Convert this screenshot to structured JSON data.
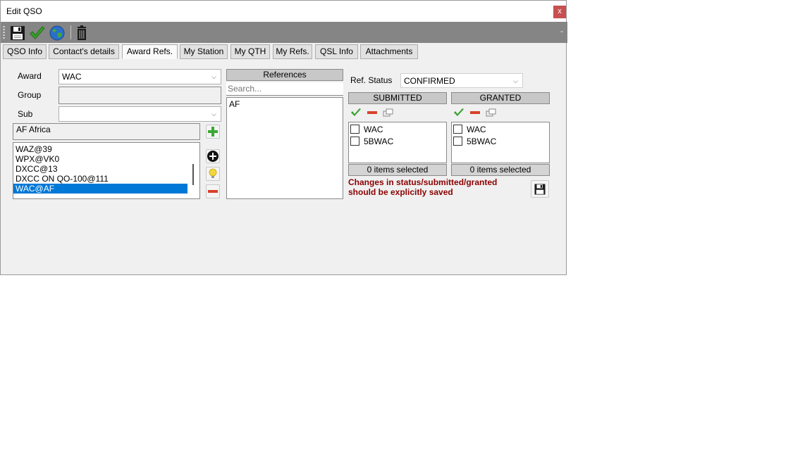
{
  "window": {
    "title": "Edit QSO",
    "close_label": "x",
    "minimize_label": "-"
  },
  "toolbar": {
    "buttons": [
      "save-icon",
      "check-icon",
      "globe-icon",
      "trash-icon"
    ]
  },
  "tabs": [
    {
      "label": "QSO Info"
    },
    {
      "label": "Contact's details"
    },
    {
      "label": "Award Refs."
    },
    {
      "label": "My Station"
    },
    {
      "label": "My QTH"
    },
    {
      "label": "My Refs."
    },
    {
      "label": "QSL Info"
    },
    {
      "label": "Attachments"
    }
  ],
  "active_tab": "Award Refs.",
  "award_form": {
    "award_label": "Award",
    "award_value": "WAC",
    "group_label": "Group",
    "group_value": "",
    "sub_label": "Sub",
    "sub_value": "",
    "selected_ref": "AF Africa"
  },
  "award_list": [
    "WAZ@39",
    "WPX@VK0",
    "DXCC@13",
    "DXCC ON QO-100@111",
    "WAC@AF"
  ],
  "award_list_selected": "WAC@AF",
  "references": {
    "header": "References",
    "search_placeholder": "Search...",
    "items": [
      "AF"
    ]
  },
  "ref_status": {
    "label": "Ref. Status",
    "value": "CONFIRMED"
  },
  "submitted": {
    "header": "SUBMITTED",
    "items": [
      "WAC",
      "5BWAC"
    ],
    "footer": "0 items selected"
  },
  "granted": {
    "header": "GRANTED",
    "items": [
      "WAC",
      "5BWAC"
    ],
    "footer": "0 items selected"
  },
  "warning": {
    "line1": "Changes in status/submitted/granted",
    "line2": "should be explicitly saved"
  },
  "colors": {
    "selection": "#0078d7",
    "warning": "#8b0000",
    "close": "#c75050"
  }
}
